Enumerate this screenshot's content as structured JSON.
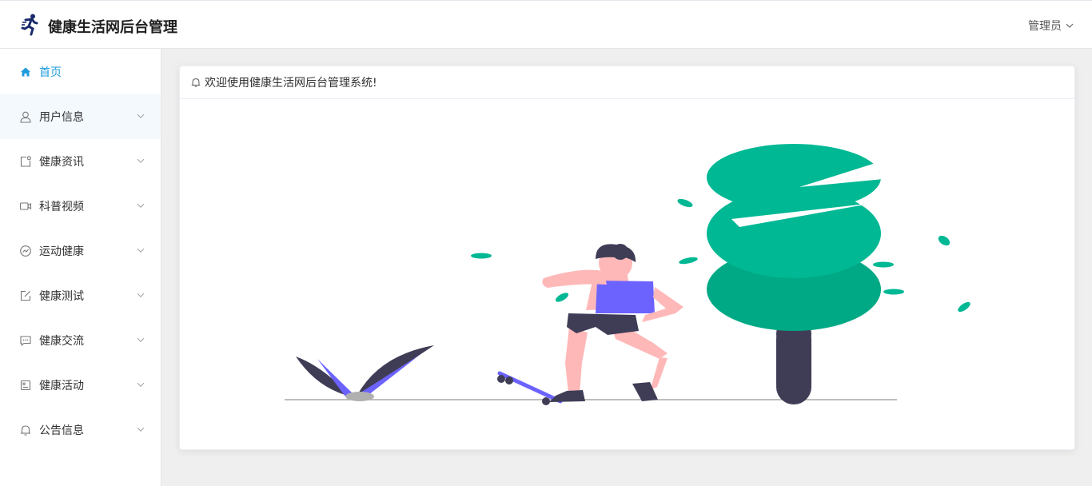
{
  "header": {
    "brand_title": "健康生活网后台管理",
    "user_label": "管理员"
  },
  "sidebar": {
    "items": [
      {
        "label": "首页",
        "icon": "home-icon",
        "active": true
      },
      {
        "label": "用户信息",
        "icon": "user-icon"
      },
      {
        "label": "健康资讯",
        "icon": "notice-card-icon"
      },
      {
        "label": "科普视频",
        "icon": "video-camera-icon"
      },
      {
        "label": "运动健康",
        "icon": "chart-circle-icon"
      },
      {
        "label": "健康测试",
        "icon": "edit-icon"
      },
      {
        "label": "健康交流",
        "icon": "chat-dots-icon"
      },
      {
        "label": "健康活动",
        "icon": "document-list-icon"
      },
      {
        "label": "公告信息",
        "icon": "bell-icon"
      }
    ]
  },
  "main": {
    "welcome_text": "欢迎使用健康生活网后台管理系统!"
  },
  "colors": {
    "accent": "#1f9bdc",
    "tree_green": "#00b894",
    "purple": "#6c63ff",
    "dark": "#3f3d56",
    "skin": "#ffb8b8"
  }
}
